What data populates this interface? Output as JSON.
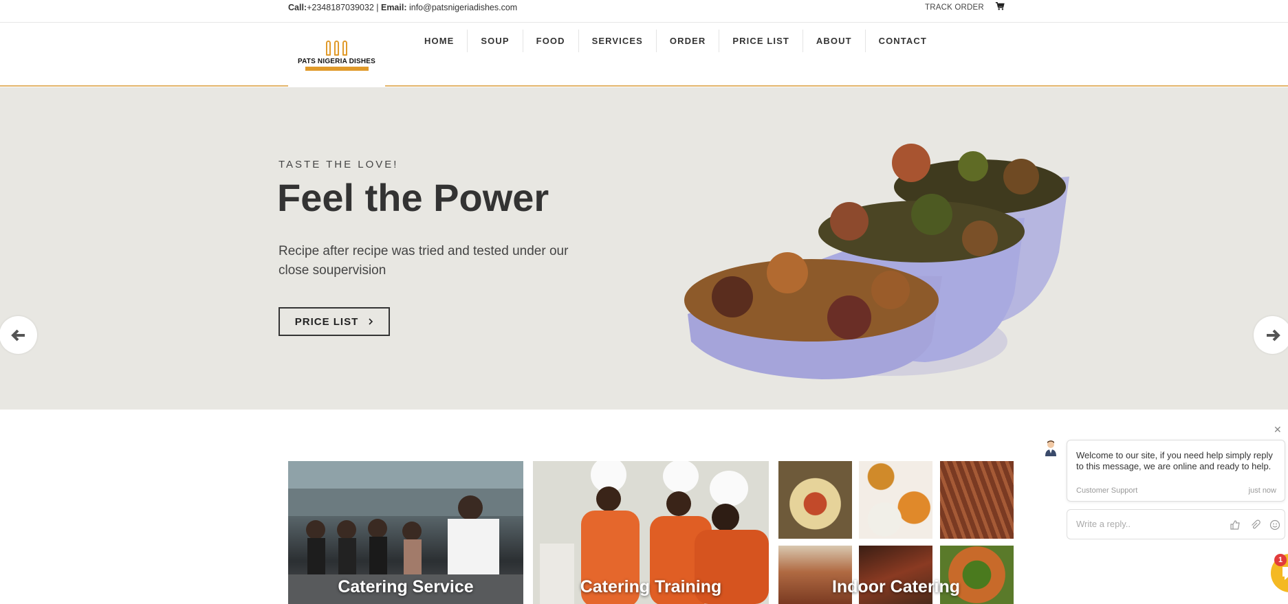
{
  "topbar": {
    "call_label": "Call:",
    "call_value": "+2348187039032 |",
    "email_label": "Email:",
    "email_value": "info@patsnigeriadishes.com",
    "track_order": "TRACK ORDER",
    "cart_icon": "cart-icon"
  },
  "header": {
    "logo_text": "PATS NIGERIA DISHES",
    "nav": [
      "HOME",
      "SOUP",
      "FOOD",
      "SERVICES",
      "ORDER",
      "PRICE LIST",
      "ABOUT",
      "CONTACT"
    ]
  },
  "hero": {
    "kicker": "TASTE THE LOVE!",
    "title": "Feel the Power",
    "description": "Recipe after recipe was tried and tested under our close soupervision",
    "cta_label": "PRICE LIST",
    "cta_icon": "chevron-right-icon",
    "prev_icon": "arrow-left-icon",
    "next_icon": "arrow-right-icon"
  },
  "services": [
    {
      "label": "Catering Service"
    },
    {
      "label": "Catering Training"
    },
    {
      "label": "Indoor Catering"
    }
  ],
  "chat": {
    "message": "Welcome to our site, if you need help simply reply to this message, we are online and ready to help.",
    "sender": "Customer Support",
    "time": "just now",
    "reply_placeholder": "Write a reply..",
    "badge_count": "1"
  },
  "colors": {
    "accent": "#e3b46a",
    "hero_bg": "#e8e7e2",
    "chat_launcher": "#f4b923",
    "badge": "#e23b3b"
  }
}
